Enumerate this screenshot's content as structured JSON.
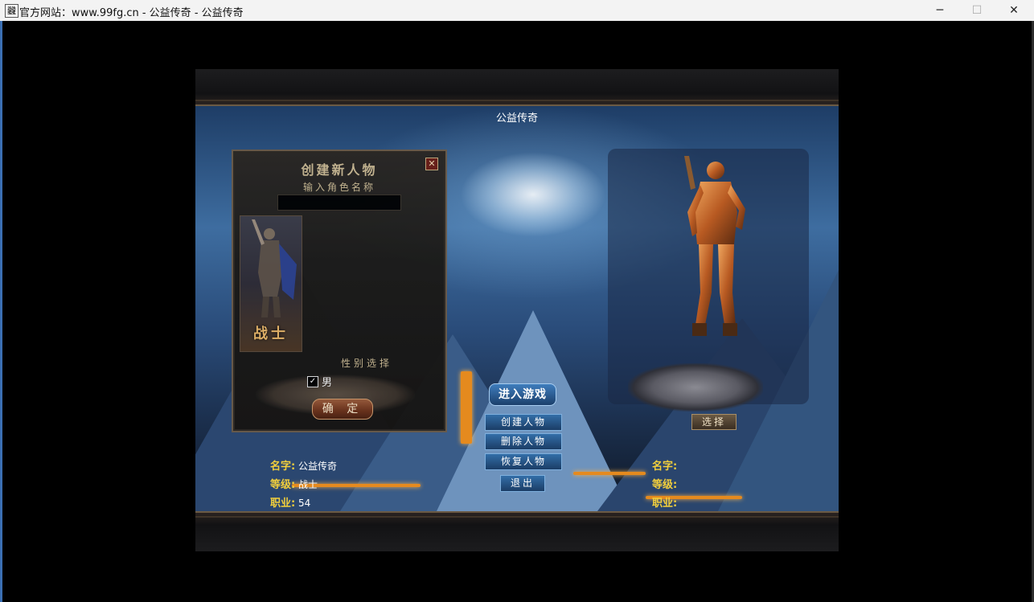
{
  "window": {
    "icon": "龖",
    "title": "官方网站：www.99fg.cn - 公益传奇 - 公益传奇",
    "minimize_icon": "─",
    "maximize_icon": "☐",
    "close_icon": "✕"
  },
  "game": {
    "title": "公益传奇",
    "create_panel": {
      "title": "创建新人物",
      "name_label": "输入角色名称",
      "name_value": "",
      "close_icon": "✕",
      "class_name": "战士",
      "gender_label": "性别选择",
      "gender_checked": "✓",
      "gender_option": "男",
      "confirm_label": "确 定"
    },
    "buttons": {
      "enter_game": "进入游戏",
      "create_char": "创建人物",
      "delete_char": "删除人物",
      "restore_char": "恢复人物",
      "exit": "退出",
      "select": "选择"
    },
    "left_info": {
      "name_label": "名字:",
      "name_value": "公益传奇",
      "level_label": "等级:",
      "level_value": "战士",
      "job_label": "职业:",
      "job_value": "54"
    },
    "right_info": {
      "name_label": "名字:",
      "level_label": "等级:",
      "job_label": "职业:"
    }
  }
}
